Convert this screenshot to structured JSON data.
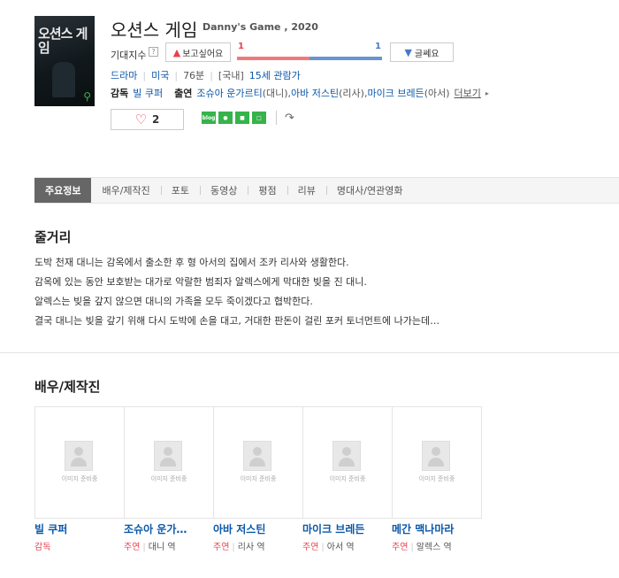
{
  "movie": {
    "title": "오션스 게임",
    "subtitle": "Danny's Game , 2020",
    "poster_title": "오션스 게임"
  },
  "expectation": {
    "label": "기대지수",
    "help": "?",
    "want_button": "보고싶어요",
    "want_count": "1",
    "dislike_count": "1",
    "dislike_button": "글쎄요",
    "want_ratio": 0.5,
    "colors": {
      "want": "#e8414f",
      "dislike": "#4a78c8"
    }
  },
  "meta": {
    "genre": "드라마",
    "country": "미국",
    "runtime": "76분",
    "rating_prefix": "[국내]",
    "rating": "15세 관람가"
  },
  "crew": {
    "director_label": "감독",
    "director": "빌 쿠퍼",
    "cast_label": "출연",
    "cast": [
      {
        "name": "조슈아 운가르티",
        "role": "(대니),"
      },
      {
        "name": "아바 저스틴",
        "role": "(리사),"
      },
      {
        "name": "마이크 브레든",
        "role": "(아서)"
      }
    ],
    "more": "더보기"
  },
  "like": {
    "count": "2",
    "icon": "heart-icon"
  },
  "share": {
    "icons": [
      "blog-icon",
      "kakao-story-icon",
      "band-icon",
      "line-icon",
      "link-share-icon"
    ],
    "blog_text": "blog"
  },
  "tabs": [
    {
      "label": "주요정보",
      "active": true
    },
    {
      "label": "배우/제작진"
    },
    {
      "label": "포토"
    },
    {
      "label": "동영상"
    },
    {
      "label": "평점"
    },
    {
      "label": "리뷰"
    },
    {
      "label": "명대사/연관영화"
    }
  ],
  "plot": {
    "heading": "줄거리",
    "lines": [
      "도박 천재 대니는 감옥에서 출소한 후 형 아서의 집에서 조카 리사와 생활한다.",
      " 감옥에 있는 동안 보호받는 대가로 악랄한 범죄자 알렉스에게 막대한 빚을 진 대니.",
      " 알렉스는 빚을 갚지 않으면 대니의 가족을 모두 죽이겠다고 협박한다.",
      " 결국 대니는 빚을 갚기 위해 다시 도박에 손을 대고, 거대한 판돈이 걸린 포커 토너먼트에 나가는데…"
    ]
  },
  "cast_section": {
    "heading": "배우/제작진",
    "placeholder": "이미지 준비중",
    "people": [
      {
        "name": "빌 쿠퍼",
        "role": "감독",
        "character": ""
      },
      {
        "name": "조슈아 운가…",
        "role": "주연",
        "character": "대니 역"
      },
      {
        "name": "아바 저스틴",
        "role": "주연",
        "character": "리사 역"
      },
      {
        "name": "마이크 브레든",
        "role": "주연",
        "character": "아서 역"
      },
      {
        "name": "메간 맥나마라",
        "role": "주연",
        "character": "알렉스 역"
      }
    ]
  }
}
